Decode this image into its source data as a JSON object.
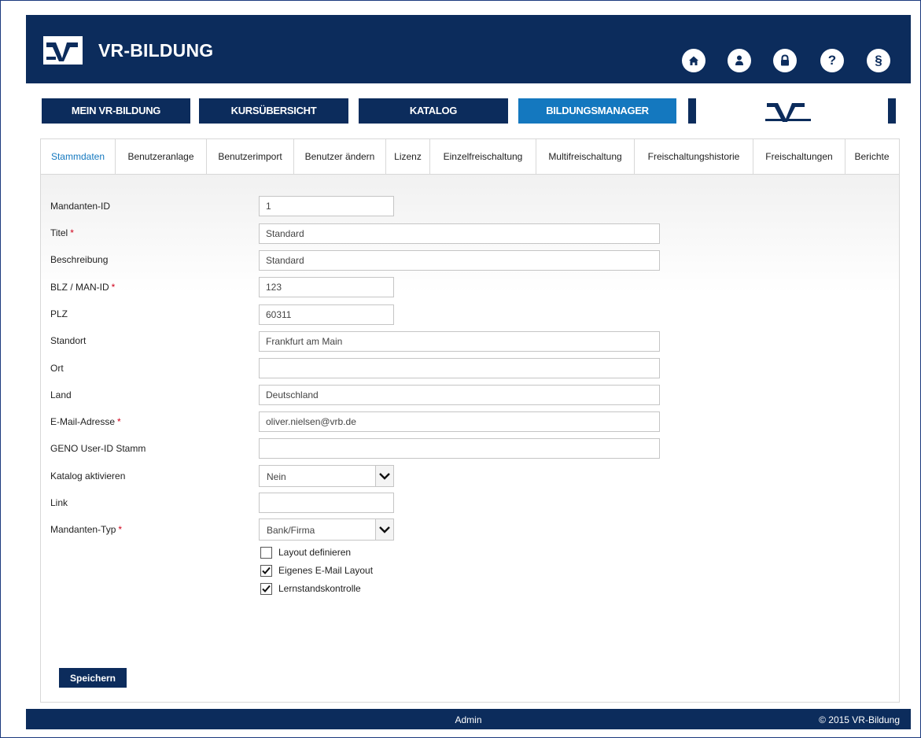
{
  "header": {
    "brand": "VR-BILDUNG",
    "icons": [
      "home-icon",
      "user-icon",
      "lock-icon",
      "help-icon",
      "paragraph-icon"
    ],
    "paragraph_glyph": "§",
    "help_glyph": "?"
  },
  "main_nav": {
    "items": [
      {
        "label": "MEIN VR-BILDUNG"
      },
      {
        "label": "KURSÜBERSICHT"
      },
      {
        "label": "KATALOG"
      },
      {
        "label": "BILDUNGSMANAGER",
        "active": true
      }
    ]
  },
  "tabs": [
    {
      "label": "Stammdaten",
      "active": true
    },
    {
      "label": "Benutzeranlage"
    },
    {
      "label": "Benutzerimport"
    },
    {
      "label": "Benutzer ändern"
    },
    {
      "label": "Lizenz"
    },
    {
      "label": "Einzelfreischaltung"
    },
    {
      "label": "Multifreischaltung"
    },
    {
      "label": "Freischaltungshistorie"
    },
    {
      "label": "Freischaltungen"
    },
    {
      "label": "Berichte"
    }
  ],
  "form": {
    "required_marker": "*",
    "fields": [
      {
        "label": "Mandanten-ID",
        "value": "1",
        "required": false
      },
      {
        "label": "Titel",
        "value": "Standard",
        "required": true
      },
      {
        "label": "Beschreibung",
        "value": "Standard",
        "required": false
      },
      {
        "label": "BLZ / MAN-ID",
        "value": "123",
        "required": true
      },
      {
        "label": "PLZ",
        "value": "60311",
        "required": false
      },
      {
        "label": "Standort",
        "value": "Frankfurt am Main",
        "required": false
      },
      {
        "label": "Ort",
        "value": "",
        "required": false
      },
      {
        "label": "Land",
        "value": "Deutschland",
        "required": false
      },
      {
        "label": "E-Mail-Adresse",
        "value": "oliver.nielsen@vrb.de",
        "required": true
      },
      {
        "label": "GENO User-ID Stamm",
        "value": "",
        "required": false
      },
      {
        "label": "Katalog aktivieren",
        "value": "Nein",
        "required": false
      },
      {
        "label": "Link",
        "value": "",
        "required": false
      },
      {
        "label": "Mandanten-Typ",
        "value": "Bank/Firma",
        "required": true
      }
    ],
    "checkboxes": [
      {
        "label": "Layout definieren",
        "checked": false
      },
      {
        "label": "Eigenes E-Mail Layout",
        "checked": true
      },
      {
        "label": "Lernstandskontrolle",
        "checked": true
      }
    ],
    "save_label": "Speichern"
  },
  "footer": {
    "user": "Admin",
    "copyright": "© 2015 VR-Bildung"
  },
  "colors": {
    "primary": "#0c2c5c",
    "accent": "#1478bf",
    "required": "#d0021b"
  }
}
